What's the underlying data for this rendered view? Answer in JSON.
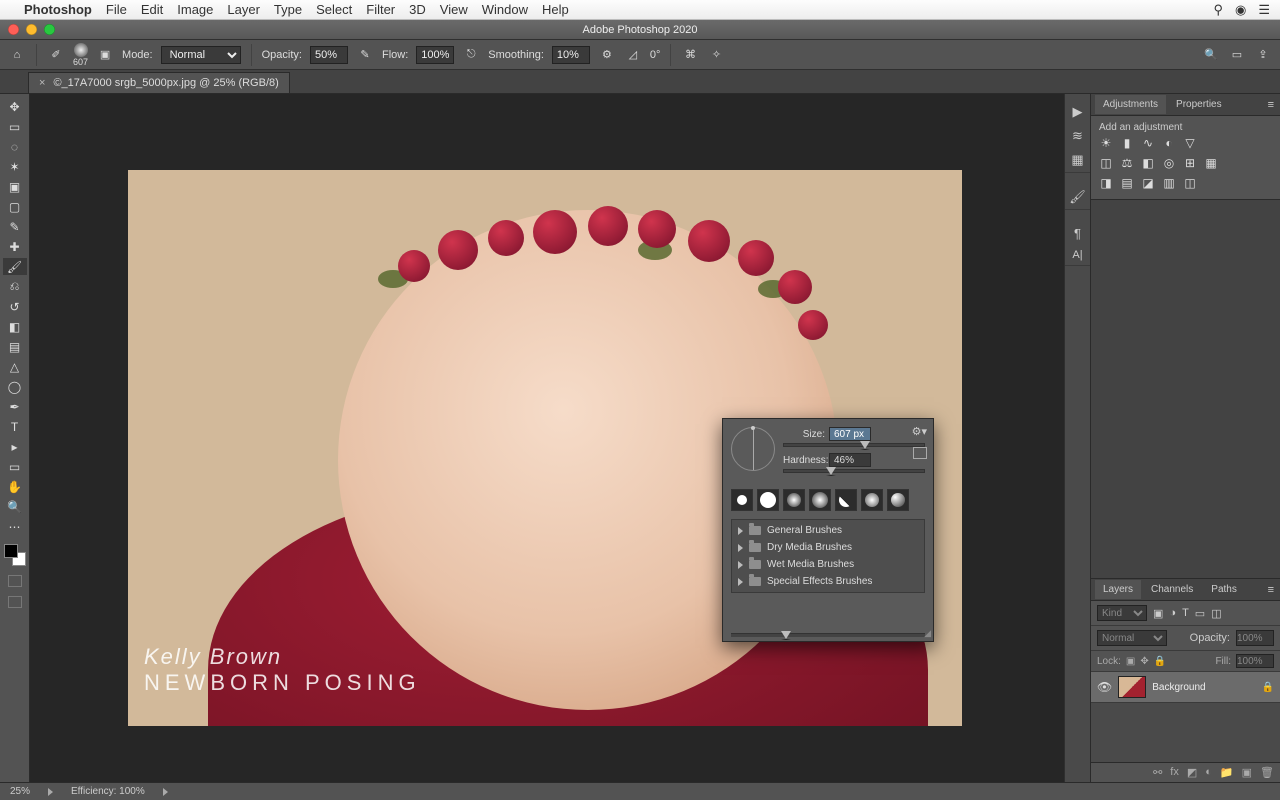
{
  "mac_menu": {
    "app": "Photoshop",
    "items": [
      "File",
      "Edit",
      "Image",
      "Layer",
      "Type",
      "Select",
      "Filter",
      "3D",
      "View",
      "Window",
      "Help"
    ]
  },
  "window_title": "Adobe Photoshop 2020",
  "options_bar": {
    "brush_size_label": "607",
    "mode_label": "Mode:",
    "mode_value": "Normal",
    "opacity_label": "Opacity:",
    "opacity_value": "50%",
    "flow_label": "Flow:",
    "flow_value": "100%",
    "smoothing_label": "Smoothing:",
    "smoothing_value": "10%",
    "angle_label": "0°"
  },
  "doc_tab": {
    "name": "©_17A7000 srgb_5000px.jpg @ 25% (RGB/8)"
  },
  "brush_popup": {
    "size_label": "Size:",
    "size_value": "607 px",
    "size_pct": 54,
    "hardness_label": "Hardness:",
    "hardness_value": "46%",
    "hardness_pct": 30,
    "folders": [
      "General Brushes",
      "Dry Media Brushes",
      "Wet Media Brushes",
      "Special Effects Brushes"
    ]
  },
  "panels": {
    "adjustments_tab": "Adjustments",
    "properties_tab": "Properties",
    "add_adjustment_label": "Add an adjustment",
    "layers_tab": "Layers",
    "channels_tab": "Channels",
    "paths_tab": "Paths",
    "kind_placeholder": "Kind",
    "blend_mode": "Normal",
    "opacity_label": "Opacity:",
    "opacity_value": "100%",
    "lock_label": "Lock:",
    "fill_label": "Fill:",
    "fill_value": "100%",
    "layer_name": "Background"
  },
  "status": {
    "zoom": "25%",
    "efficiency": "Efficiency: 100%"
  },
  "watermark": {
    "script": "Kelly Brown",
    "caps": "NEWBORN POSING"
  }
}
